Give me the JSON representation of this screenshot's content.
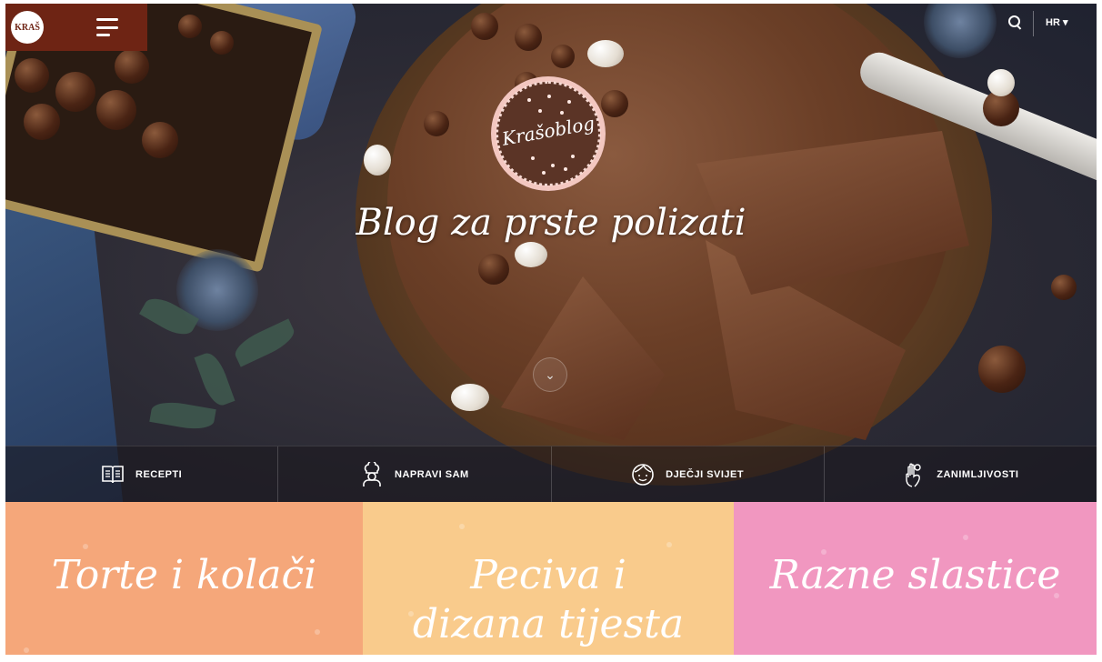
{
  "header": {
    "logo_text": "KRAŠ",
    "language": "HR ▾"
  },
  "hero": {
    "badge": "Krašoblog",
    "tagline": "Blog za prste polizati",
    "scroll_icon": "⌄"
  },
  "categories": [
    {
      "label": "RECEPTI",
      "icon": "book-icon"
    },
    {
      "label": "NAPRAVI SAM",
      "icon": "chef-icon"
    },
    {
      "label": "DJEČJI SVIJET",
      "icon": "child-face-icon"
    },
    {
      "label": "ZANIMLJIVOSTI",
      "icon": "ok-hand-icon"
    }
  ],
  "tiles": [
    {
      "title": "Torte i kolači",
      "color": "#f5a77a"
    },
    {
      "title": "Peciva i dizana tijesta",
      "color": "#f9cb8c"
    },
    {
      "title": "Razne slastice",
      "color": "#f197c0"
    }
  ],
  "colors": {
    "header_brand": "#6e2414",
    "badge_bg": "#5b3426"
  }
}
